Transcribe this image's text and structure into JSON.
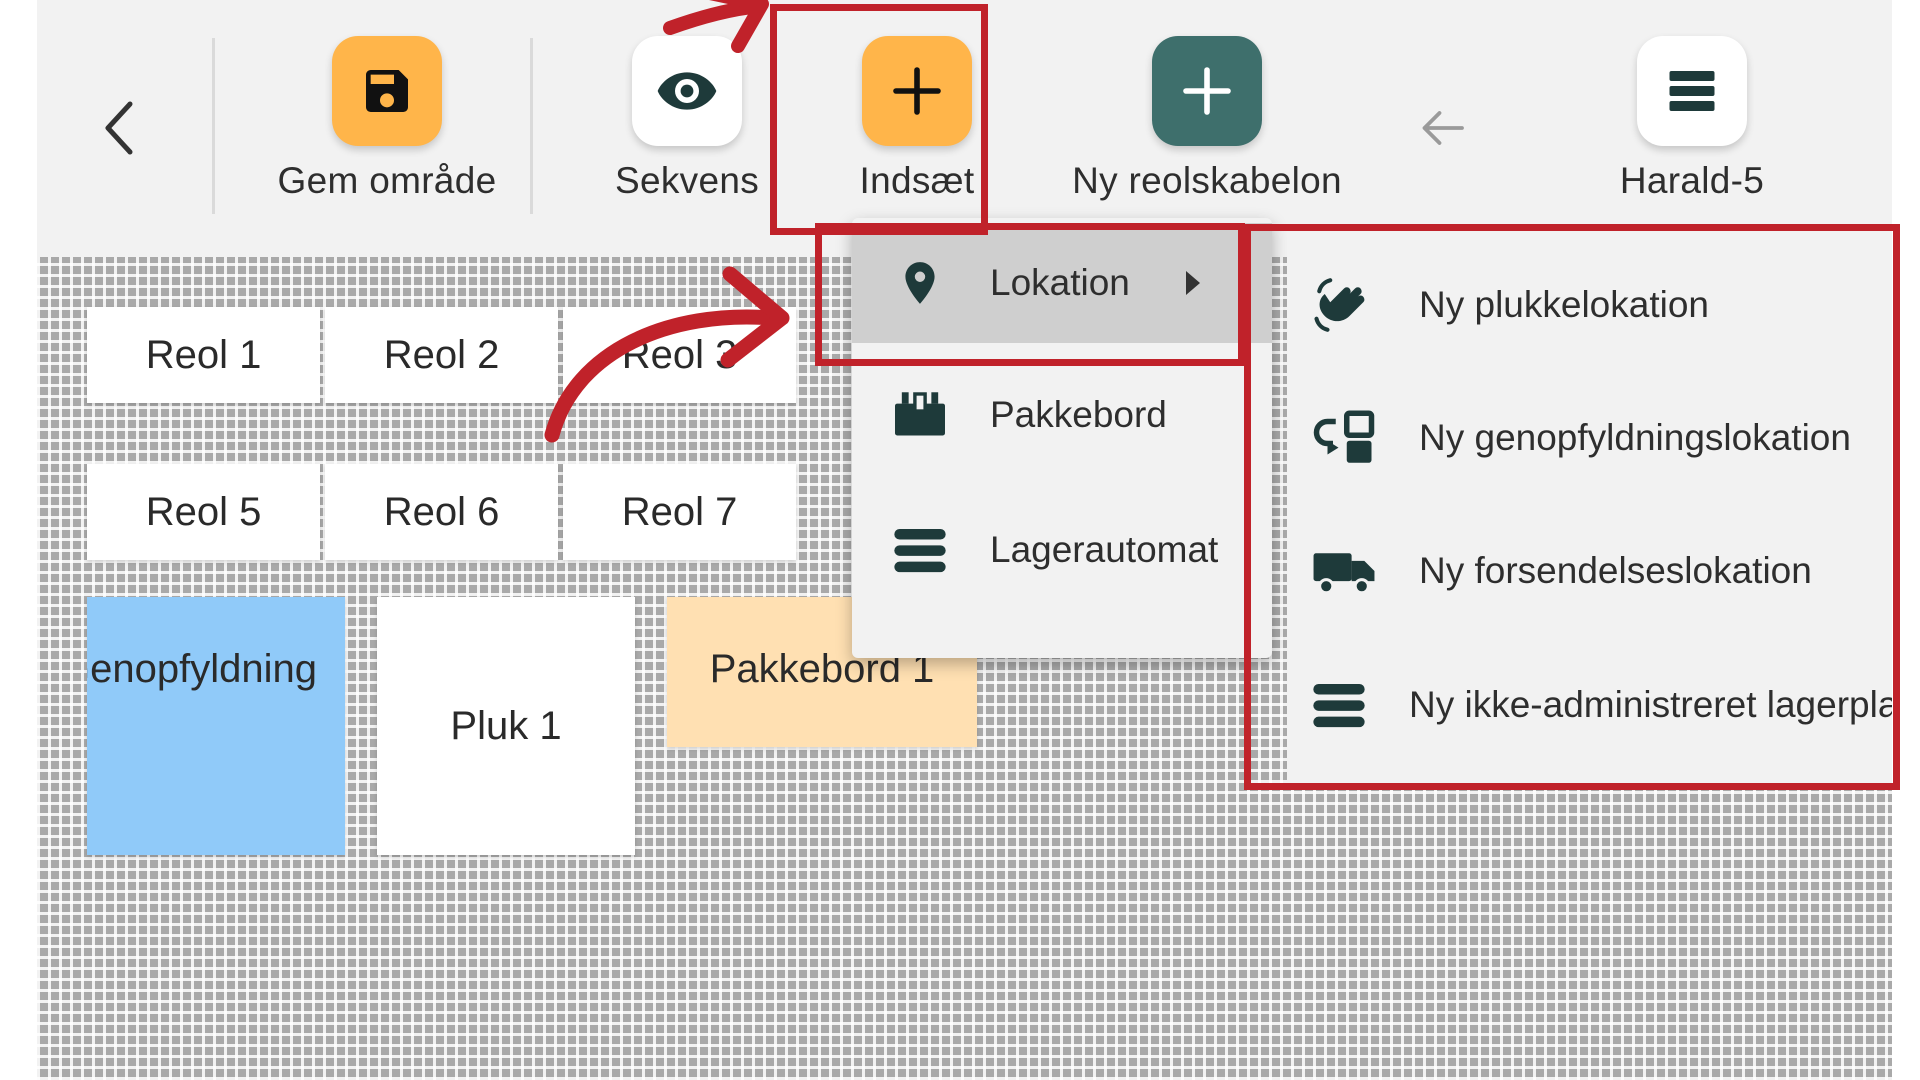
{
  "toolbar": {
    "back_label": "Tilbage",
    "buttons": [
      {
        "label": "Gem område",
        "icon": "save-icon",
        "color": "#ffb54a"
      },
      {
        "label": "Sekvens",
        "icon": "eye-icon",
        "color": "#ffffff"
      },
      {
        "label": "Indsæt",
        "icon": "plus-icon",
        "color": "#ffb54a"
      },
      {
        "label": "Ny reolskabelon",
        "icon": "plus-icon",
        "color": "#3e6f6c"
      },
      {
        "label": "Harald-5",
        "icon": "list-icon",
        "color": "#ffffff"
      }
    ],
    "arrow_icon": "arrow-left-icon"
  },
  "canvas": {
    "tiles": [
      {
        "label": "Reol 1",
        "color": "#ffffff"
      },
      {
        "label": "Reol 2",
        "color": "#ffffff"
      },
      {
        "label": "Reol 3",
        "color": "#ffffff"
      },
      {
        "label": "Reol 5",
        "color": "#ffffff"
      },
      {
        "label": "Reol 6",
        "color": "#ffffff"
      },
      {
        "label": "Reol 7",
        "color": "#ffffff"
      },
      {
        "label": "Genopfyldning",
        "color": "#90caf9"
      },
      {
        "label": "Pluk 1",
        "color": "#ffffff"
      },
      {
        "label": "Pakkebord 1",
        "color": "#ffe0b2"
      }
    ]
  },
  "menu": {
    "items": [
      {
        "label": "Lokation",
        "icon": "location-pin-icon",
        "has_submenu": true
      },
      {
        "label": "Pakkebord",
        "icon": "package-table-icon"
      },
      {
        "label": "Lagerautomat",
        "icon": "storage-lines-icon"
      }
    ]
  },
  "submenu": {
    "items": [
      {
        "label": "Ny plukkelokation",
        "icon": "hand-wave-icon"
      },
      {
        "label": "Ny genopfyldningslokation",
        "icon": "refill-icon"
      },
      {
        "label": "Ny forsendelseslokation",
        "icon": "truck-icon"
      },
      {
        "label": "Ny ikke-administreret lagerplads",
        "icon": "storage-lines-icon"
      }
    ]
  },
  "annotations": {
    "highlight_color": "#c0222a"
  }
}
